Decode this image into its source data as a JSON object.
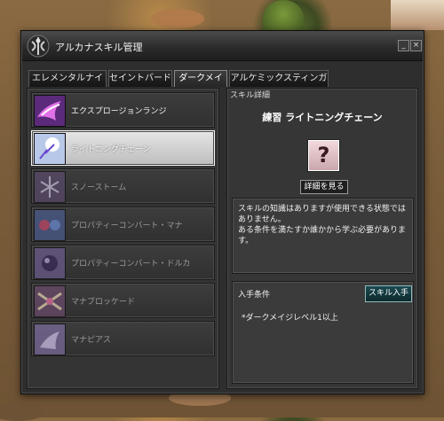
{
  "window": {
    "title": "アルカナスキル管理",
    "minimize_label": "_",
    "close_label": "×"
  },
  "tabs": [
    {
      "label": "エレメンタルナイト",
      "active": false
    },
    {
      "label": "セイントバード",
      "active": false
    },
    {
      "label": "ダークメイジ",
      "active": true
    },
    {
      "label": "アルケミックスティンガー",
      "active": false
    }
  ],
  "skills": [
    {
      "label": "エクスプロージョンランジ",
      "state": "learned",
      "icon": "explosion-icon"
    },
    {
      "label": "ライトニングチェーン",
      "state": "selected",
      "icon": "lightning-icon"
    },
    {
      "label": "スノーストーム",
      "state": "locked",
      "icon": "snowstorm-icon"
    },
    {
      "label": "プロパティーコンバート・マナ",
      "state": "locked",
      "icon": "mana-convert-icon"
    },
    {
      "label": "プロパティーコンバート・ドルカ",
      "state": "locked",
      "icon": "dolca-convert-icon"
    },
    {
      "label": "マナブロッケード",
      "state": "locked",
      "icon": "mana-blockade-icon"
    },
    {
      "label": "マナピアス",
      "state": "locked",
      "icon": "mana-pierce-icon"
    }
  ],
  "detail": {
    "header": "スキル詳細",
    "title": "練習 ライトニングチェーン",
    "unknown_icon": "?",
    "detail_button": "詳細を見る",
    "description": "スキルの知識はありますが使用できる状態ではありません。\nある条件を満たすか誰かから学ぶ必要があります。",
    "acquire_label": "入手条件",
    "acquire_button": "スキル入手",
    "condition": "*ダークメイジレベル1以上"
  },
  "colors": {
    "window_bg": "#2e2e2e",
    "selected_row": "#d8d8d8",
    "acquire_button": "#143a3f",
    "unknown_icon_bg": "#e6c8cc"
  }
}
